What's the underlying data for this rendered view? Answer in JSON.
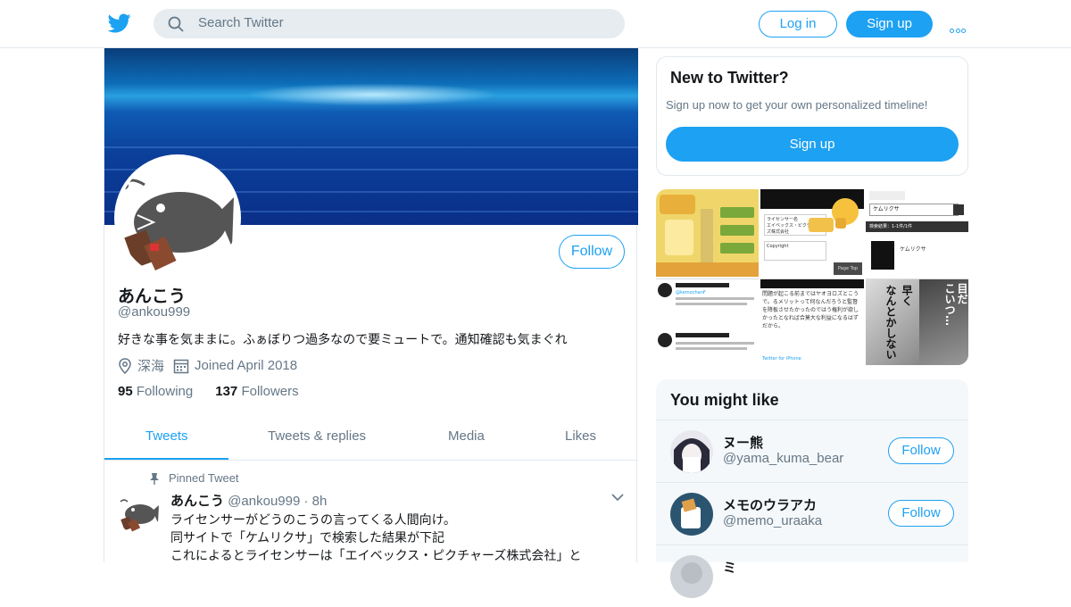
{
  "header": {
    "logo_icon": "twitter-bird-icon",
    "search_placeholder": "Search Twitter",
    "login_label": "Log in",
    "signup_label": "Sign up",
    "more_icon": "more-dots-icon",
    "accent_color": "#1da1f2"
  },
  "profile": {
    "name": "あんこう",
    "handle": "@ankou999",
    "bio": "好きな事を気ままに。ふぁぼりつ過多なので要ミュートで。通知確認も気まぐれ",
    "location": "深海",
    "joined": "Joined April 2018",
    "following_count": "95",
    "following_label": "Following",
    "followers_count": "137",
    "followers_label": "Followers",
    "follow_label": "Follow"
  },
  "tabs": [
    {
      "label": "Tweets",
      "active": true
    },
    {
      "label": "Tweets & replies",
      "active": false
    },
    {
      "label": "Media",
      "active": false
    },
    {
      "label": "Likes",
      "active": false
    }
  ],
  "tweet": {
    "pinned_label": "Pinned Tweet",
    "author_name": "あんこう",
    "author_handle": "@ankou999",
    "separator": "·",
    "time": "8h",
    "lines": [
      "ライセンサーがどうのこうの言ってくる人間向け。",
      "同サイトで「ケムリクサ」で検索した結果が下記",
      "これによるとライセンサーは「エイベックス・ピクチャーズ株式会社」と"
    ]
  },
  "sidebar": {
    "new_title": "New to Twitter?",
    "new_subtitle": "Sign up now to get your own personalized timeline!",
    "signup_label": "Sign up",
    "media_texts": {
      "licensor_label": "ライセンサー名",
      "licensor_value": "エイベックス・ピクチャーズ株式会社",
      "copyright_label": "Copyright",
      "search_term": "ケムリクサ",
      "results_label": "検索結果：1-1件/1件",
      "page_top": "Page Top",
      "reply_handle": "@kemochanF",
      "manga_line1": "早く",
      "manga_line2": "なんとかしない",
      "manga_line3": "こいつ…",
      "manga_line4": "目だ",
      "tweet_text": "問題が起こる前まではヤオヨロズとこうで。るメリットって何なんだろうと監督を降板させたかったのではう権利が欲しかったとなれば合莫大な利益になるはずだから。",
      "via_iphone": "Twitter for iPhone"
    },
    "you_might_like_title": "You might like",
    "suggestions": [
      {
        "name": "ヌー熊",
        "handle": "@yama_kuma_bear",
        "follow_label": "Follow"
      },
      {
        "name": "メモのウラアカ",
        "handle": "@memo_uraaka",
        "follow_label": "Follow"
      },
      {
        "name": "ミ",
        "handle": "",
        "follow_label": ""
      }
    ]
  }
}
